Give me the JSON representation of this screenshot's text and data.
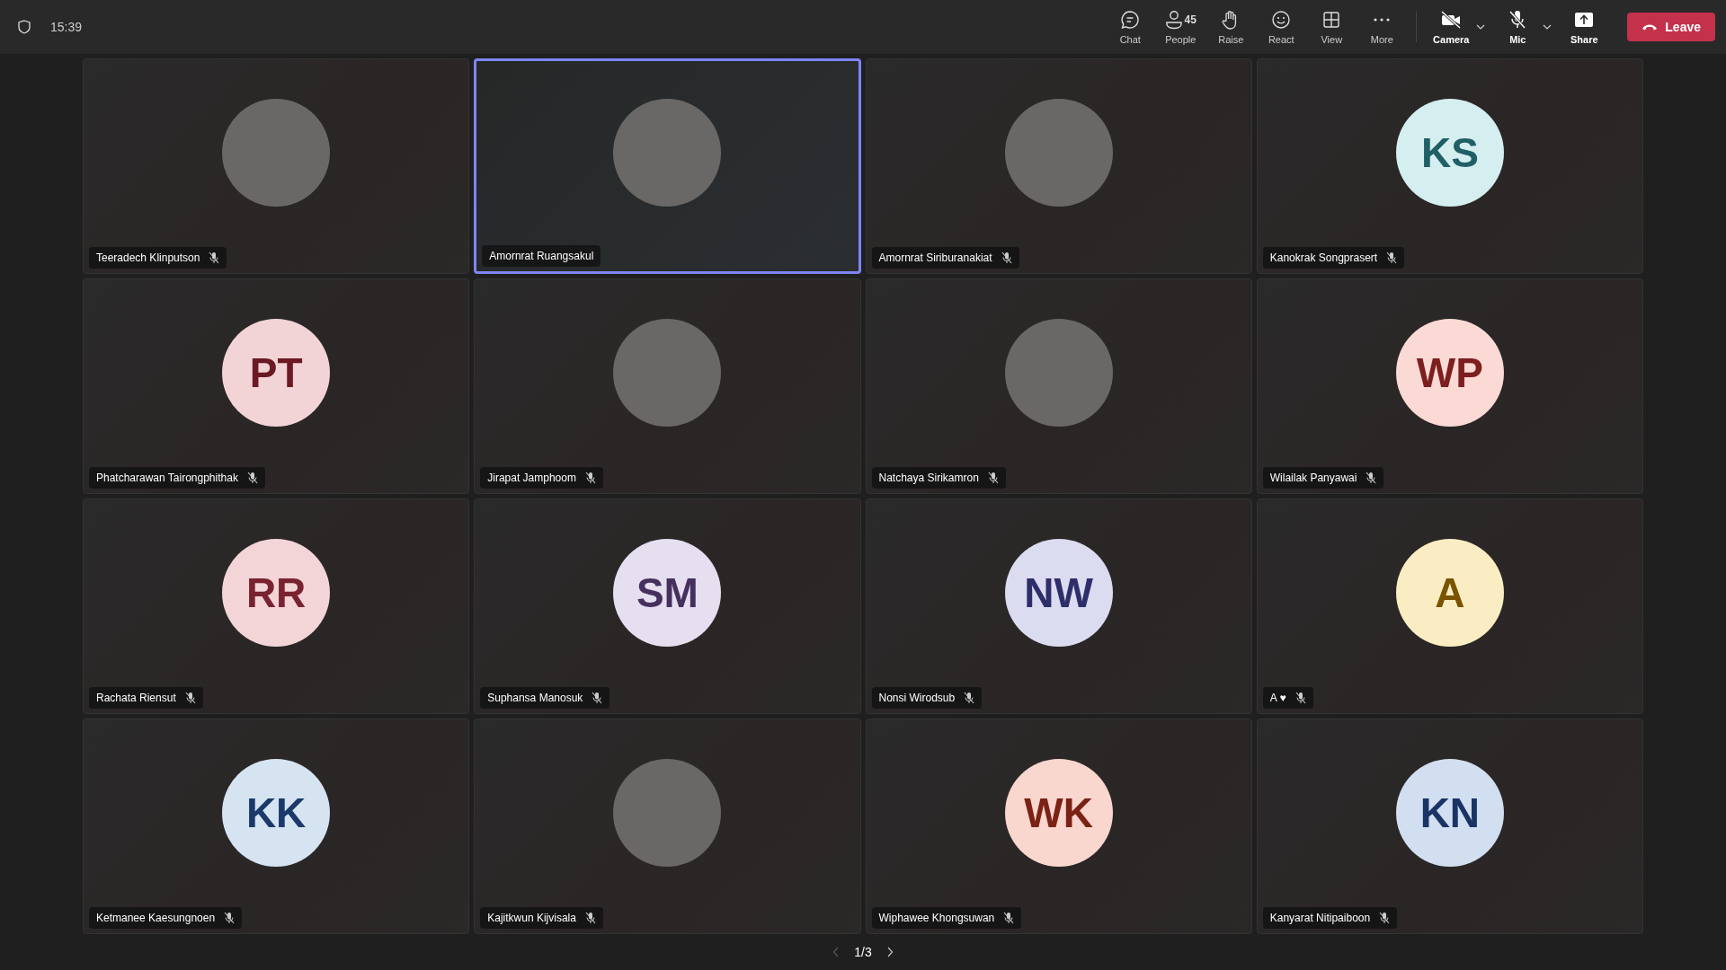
{
  "top_bar": {
    "time": "15:39",
    "tools": [
      {
        "kind": "chat",
        "label": "Chat"
      },
      {
        "kind": "people",
        "label": "People",
        "count": "45"
      },
      {
        "kind": "raise",
        "label": "Raise"
      },
      {
        "kind": "react",
        "label": "React"
      },
      {
        "kind": "view",
        "label": "View"
      },
      {
        "kind": "more",
        "label": "More"
      }
    ],
    "devices": [
      {
        "kind": "camera",
        "label": "Camera",
        "on": false
      },
      {
        "kind": "mic",
        "label": "Mic",
        "on": false
      },
      {
        "kind": "share",
        "label": "Share"
      }
    ],
    "leave": "Leave"
  },
  "participants": [
    {
      "name": "Teeradech Klinputson",
      "kind": "photo",
      "muted": true,
      "selected": false
    },
    {
      "name": "Amornrat Ruangsakul",
      "kind": "photo",
      "muted": false,
      "selected": true
    },
    {
      "name": "Amornrat Siriburanakiat",
      "kind": "photo",
      "muted": true,
      "selected": false
    },
    {
      "name": "Kanokrak Songprasert",
      "kind": "initials",
      "initials": "KS",
      "color": "#d5eef0",
      "muted": true,
      "selected": false
    },
    {
      "name": "Phatcharawan Tairongphithak",
      "kind": "initials",
      "initials": "PT",
      "color": "#f2d4d7",
      "muted": true,
      "selected": false
    },
    {
      "name": "Jirapat Jamphoom",
      "kind": "photo",
      "muted": true,
      "selected": false
    },
    {
      "name": "Natchaya Sirikamron",
      "kind": "photo",
      "muted": true,
      "selected": false
    },
    {
      "name": "Wilailak Panyawai",
      "kind": "initials",
      "initials": "WP",
      "color": "#fbd9d5",
      "muted": true,
      "selected": false
    },
    {
      "name": "Rachata Riensut",
      "kind": "initials",
      "initials": "RR",
      "color": "#f3d5d8",
      "muted": true,
      "selected": false
    },
    {
      "name": "Suphansa Manosuk",
      "kind": "initials",
      "initials": "SM",
      "color": "#e5dff0",
      "muted": true,
      "selected": false
    },
    {
      "name": "Nonsi Wirodsub",
      "kind": "initials",
      "initials": "NW",
      "color": "#dcdcf0",
      "muted": true,
      "selected": false
    },
    {
      "name": "A ♥",
      "kind": "initials",
      "initials": "A",
      "color": "#fbedc3",
      "muted": true,
      "selected": false
    },
    {
      "name": "Ketmanee Kaesungnoen",
      "kind": "initials",
      "initials": "KK",
      "color": "#d6e4f2",
      "muted": true,
      "selected": false
    },
    {
      "name": "Kajitkwun Kijvisala",
      "kind": "photo",
      "muted": true,
      "selected": false
    },
    {
      "name": "Wiphawee Khongsuwan",
      "kind": "initials",
      "initials": "WK",
      "color": "#f9d6ce",
      "muted": true,
      "selected": false
    },
    {
      "name": "Kanyarat Nitipaiboon",
      "kind": "initials",
      "initials": "KN",
      "color": "#d2dff0",
      "muted": true,
      "selected": false
    }
  ],
  "pager": {
    "label": "1/3"
  }
}
